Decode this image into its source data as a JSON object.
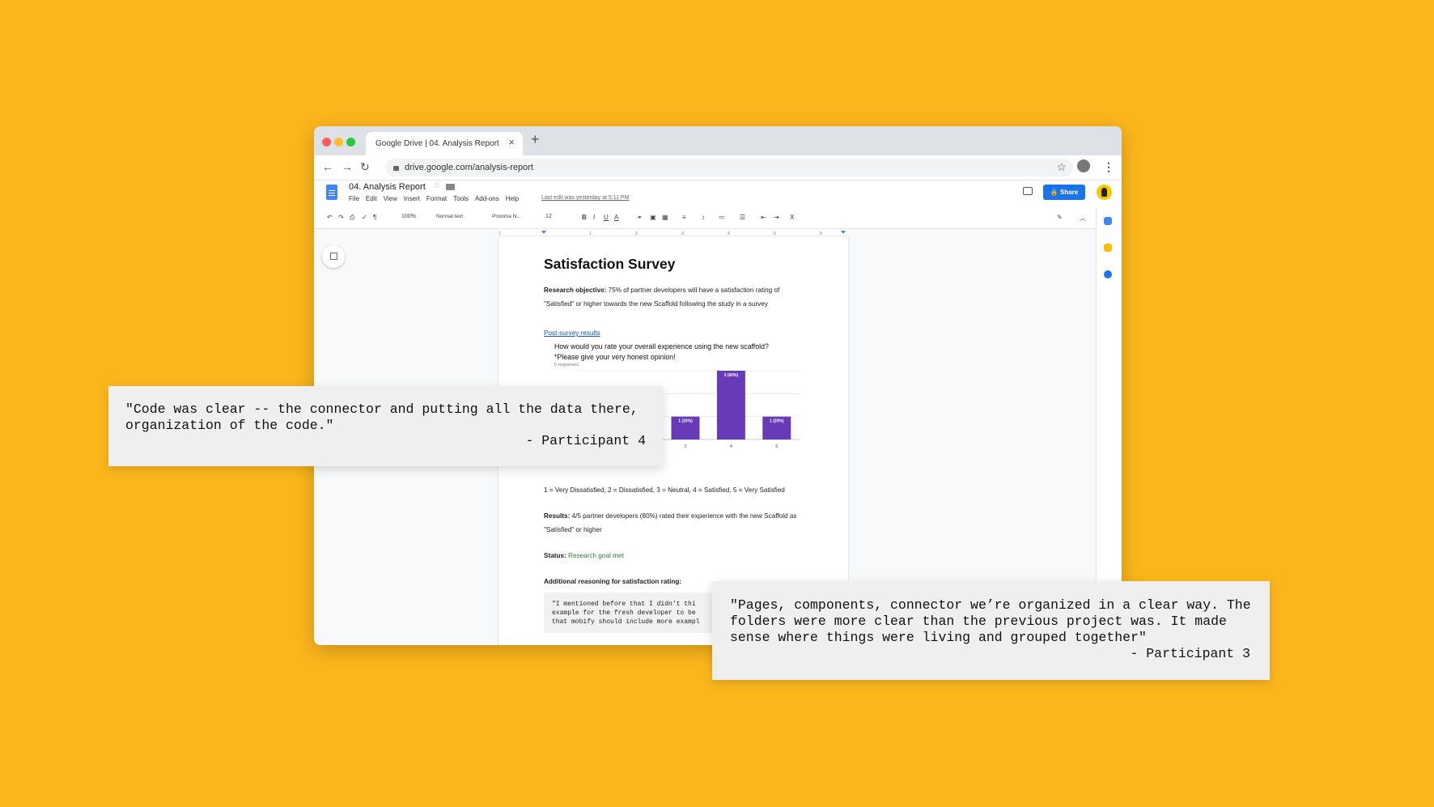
{
  "browser": {
    "tab_title": "Google Drive | 04. Analysis Report",
    "tab_close": "×",
    "new_tab": "+",
    "url": "drive.google.com/analysis-report",
    "traffic_colors": [
      "#FF5F57",
      "#FEBC2E",
      "#28C840"
    ]
  },
  "docs": {
    "title": "04. Analysis Report",
    "menu": [
      "File",
      "Edit",
      "View",
      "Insert",
      "Format",
      "Tools",
      "Add-ons",
      "Help"
    ],
    "last_edit": "Last edit was yesterday at 5:11 PM",
    "share_label": "🔒 Share",
    "toolbar": {
      "zoom": "100%",
      "style": "Normal text",
      "font": "Proxima N...",
      "size": "12"
    },
    "ruler_marks": [
      "1",
      "1",
      "2",
      "3",
      "4",
      "5",
      "6",
      "7"
    ]
  },
  "document": {
    "heading": "Satisfaction Survey",
    "objective_label": "Research objective:",
    "objective_text_1": " 75% of partner developers will have a satisfaction rating of",
    "objective_text_2": "\"Satisfied\" or higher towards the new Scaffold following the study in a survey",
    "survey_link": "Post-survey results",
    "question_1": "How would you rate your overall experience using the new scaffold?",
    "question_2": "*Please give your very honest opinion!",
    "responses": "5 responses",
    "scale": "1 = Very Dissatisfied, 2 = Dissatisfied, 3 = Neutral, 4 = Satisfied, 5 = Very Satisfied",
    "results_label": "Results:",
    "results_text_1": " 4/5 partner developers (80%) rated their experience with the new Scaffold as",
    "results_text_2": "\"Satisfied\" or higher",
    "status_label": "Status:",
    "status_value": " Research goal met",
    "reasoning_label": "Additional reasoning for satisfaction rating:",
    "code_quote": [
      "\"I mentioned before that I didn't thi",
      "example for the fresh developer to be",
      "that mobify should include more exampl"
    ]
  },
  "chart_data": {
    "type": "bar",
    "categories": [
      "1",
      "2",
      "3",
      "4",
      "5"
    ],
    "values": [
      0,
      0,
      1,
      3,
      1
    ],
    "labels": [
      "",
      "",
      "1 (20%)",
      "3 (60%)",
      "1 (20%)"
    ],
    "partial_label": "%)",
    "y_tick": "0",
    "ylim": [
      0,
      3
    ],
    "color": "#673AB7"
  },
  "quotes": [
    {
      "lines": [
        "\"Code was clear -- the connector and putting all the data there,",
        "organization of the code.\""
      ],
      "attribution": "-  Participant 4"
    },
    {
      "lines": [
        "\"Pages, components, connector we’re organized in a clear way. The",
        "folders were more clear than the previous project was. It made",
        "sense where things were living and grouped together\""
      ],
      "attribution": "-  Participant 3"
    }
  ]
}
